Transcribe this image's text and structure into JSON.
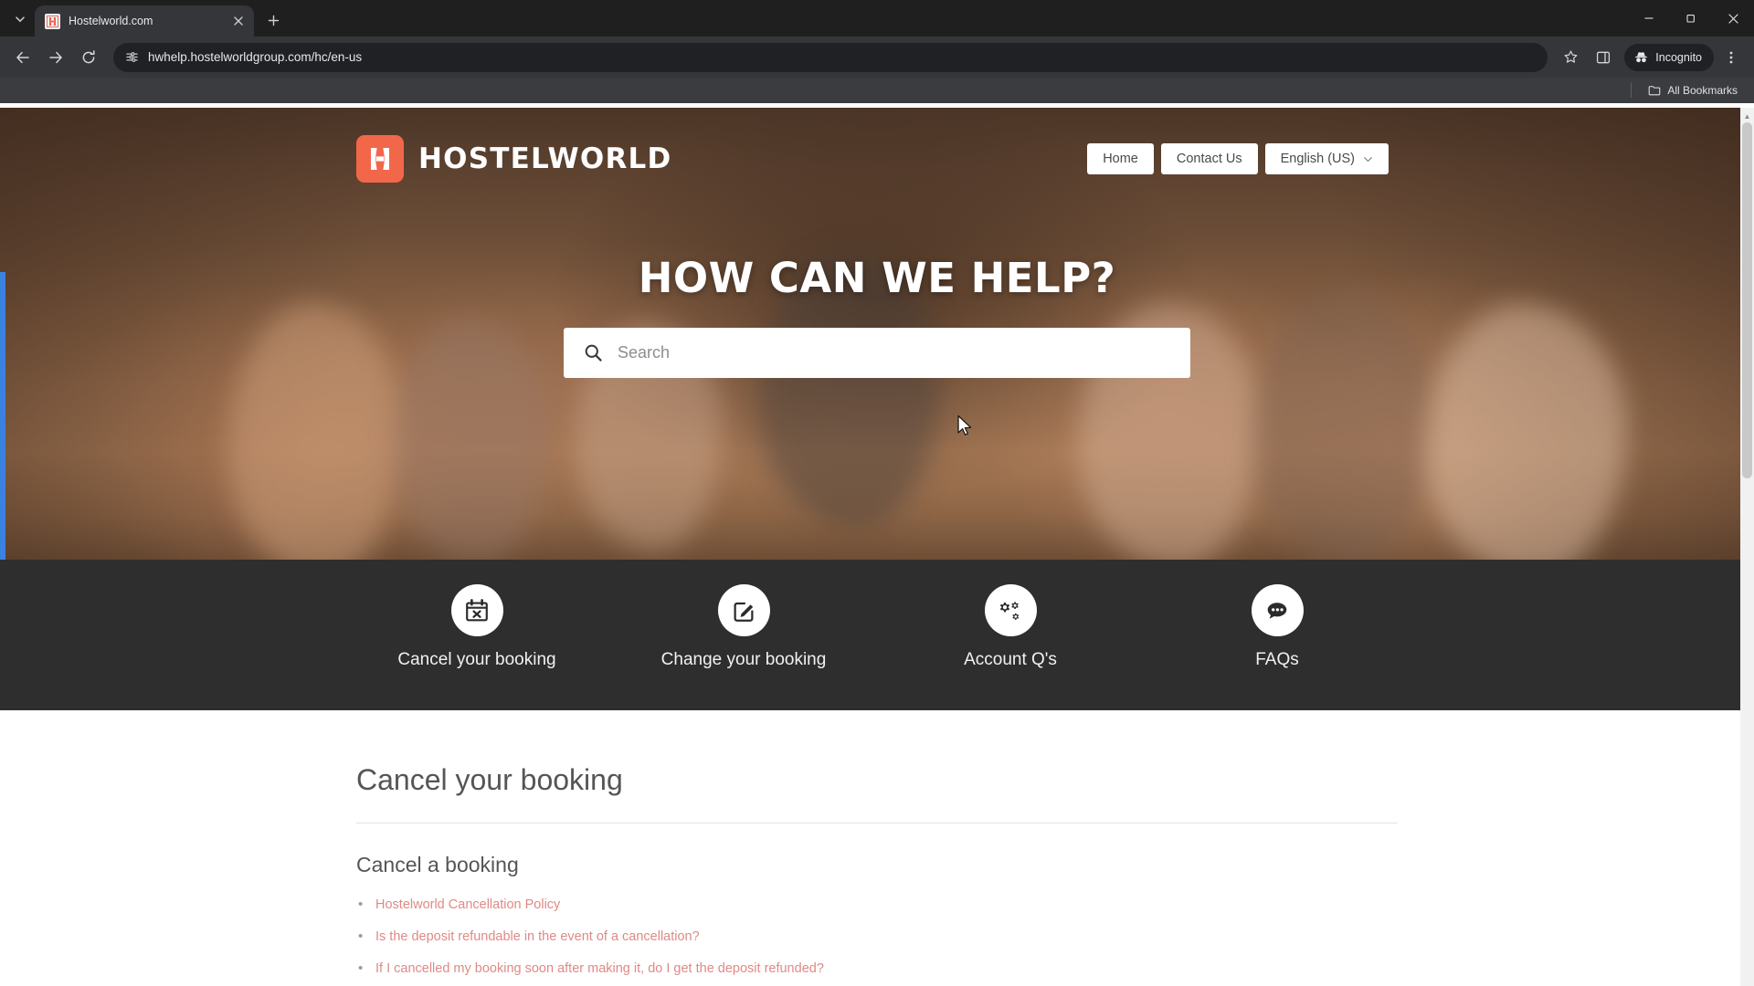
{
  "browser": {
    "tab": {
      "title": "Hostelworld.com",
      "favicon_icon": "hostelworld-favicon",
      "close_icon": "close-icon"
    },
    "tab_list_icon": "chevron-down-icon",
    "new_tab_icon": "plus-icon",
    "new_tab_label": "+",
    "window_controls": {
      "minimize": "minimize-icon",
      "maximize": "maximize-icon",
      "close": "close-icon"
    },
    "nav": {
      "back_icon": "back-arrow-icon",
      "forward_icon": "forward-arrow-icon",
      "reload_icon": "reload-icon"
    },
    "omnibox": {
      "site_info_icon": "site-settings-icon",
      "url": "hwhelp.hostelworldgroup.com/hc/en-us"
    },
    "actions": {
      "bookmark_icon": "star-icon",
      "side_panel_icon": "side-panel-icon",
      "menu_icon": "three-dot-menu-icon"
    },
    "incognito": {
      "label": "Incognito",
      "icon": "incognito-icon"
    },
    "bookmarks_bar": {
      "all_bookmarks_label": "All Bookmarks",
      "folder_icon": "folder-icon"
    }
  },
  "hero": {
    "logo": {
      "text": "HOSTELWORLD",
      "mark_icon": "hostelworld-logo-icon",
      "brand_color": "#f2674a"
    },
    "nav_buttons": [
      {
        "label": "Home",
        "name": "home"
      },
      {
        "label": "Contact Us",
        "name": "contact-us"
      },
      {
        "label": "English (US)",
        "name": "language-selector",
        "icon": "chevron-down-icon"
      }
    ],
    "title": "HOW CAN WE HELP?",
    "search": {
      "placeholder": "Search",
      "value": "",
      "icon": "search-icon"
    }
  },
  "categories": [
    {
      "label": "Cancel your booking",
      "icon": "calendar-cancel-icon"
    },
    {
      "label": "Change your booking",
      "icon": "edit-square-icon"
    },
    {
      "label": "Account Q's",
      "icon": "gears-icon"
    },
    {
      "label": "FAQs",
      "icon": "speech-bubble-icon"
    }
  ],
  "article": {
    "page_title": "Cancel your booking",
    "sections": [
      {
        "title": "Cancel a booking",
        "links": [
          "Hostelworld Cancellation Policy",
          "Is the deposit refundable in the event of a cancellation?",
          "If I cancelled my booking soon after making it, do I get the deposit refunded?"
        ]
      }
    ]
  },
  "colors": {
    "link": "#de8a85",
    "band": "#2e2e2e",
    "focus_ring": "#3b82e0"
  }
}
